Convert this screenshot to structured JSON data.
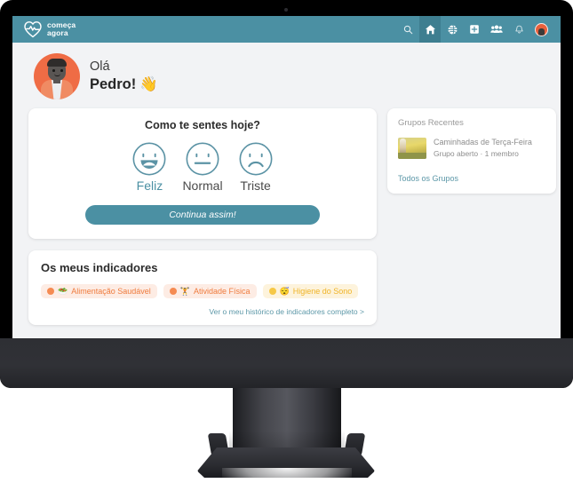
{
  "brand": {
    "line1": "começa",
    "line2": "agora",
    "mark_icon": "heart-pulse-icon",
    "color": "#4b90a3"
  },
  "header": {
    "background": "#4b90a3",
    "nav": [
      {
        "id": "search",
        "icon": "search-icon",
        "active": false
      },
      {
        "id": "home",
        "icon": "home-icon",
        "active": true
      },
      {
        "id": "explore",
        "icon": "globe-icon",
        "active": false
      },
      {
        "id": "add",
        "icon": "plus-square-icon",
        "active": false
      },
      {
        "id": "groups",
        "icon": "people-group-icon",
        "active": false
      },
      {
        "id": "notifications",
        "icon": "bell-icon",
        "active": false
      },
      {
        "id": "profile",
        "icon": "user-avatar-icon",
        "active": false
      }
    ]
  },
  "greeting": {
    "avatar_icon": "user-avatar-illustration",
    "line1": "Olá",
    "name": "Pedro!",
    "wave_emoji": "👋"
  },
  "mood": {
    "title": "Como te sentes hoje?",
    "options": [
      {
        "id": "feliz",
        "label": "Feliz",
        "icon": "happy-face-icon",
        "selected": true
      },
      {
        "id": "normal",
        "label": "Normal",
        "icon": "neutral-face-icon",
        "selected": false
      },
      {
        "id": "triste",
        "label": "Triste",
        "icon": "sad-face-icon",
        "selected": false
      }
    ],
    "button_label": "Continua assim!",
    "button_color": "#4b90a3",
    "selected_color": "#4b90a3"
  },
  "indicators": {
    "title": "Os meus indicadores",
    "badges": [
      {
        "label": "Alimentação Saudável",
        "emoji": "🥗",
        "dot_color": "#f58b52",
        "text_color": "#ef7c3e",
        "bg_color": "#fdece4"
      },
      {
        "label": "Atividade Física",
        "emoji": "🏋",
        "dot_color": "#f58b52",
        "text_color": "#ef7c3e",
        "bg_color": "#fdece4"
      },
      {
        "label": "Higiene do Sono",
        "emoji": "😴",
        "dot_color": "#f6c846",
        "text_color": "#f0b429",
        "bg_color": "#fdf3dc"
      }
    ],
    "link": "Ver o meu histórico de indicadores completo >"
  },
  "groups": {
    "title": "Grupos Recentes",
    "items": [
      {
        "name": "Caminhadas de Terça-Feira",
        "meta": "Grupo aberto · 1 membro",
        "thumb_icon": "group-photo-thumbnail"
      }
    ],
    "link": "Todos os Grupos"
  }
}
